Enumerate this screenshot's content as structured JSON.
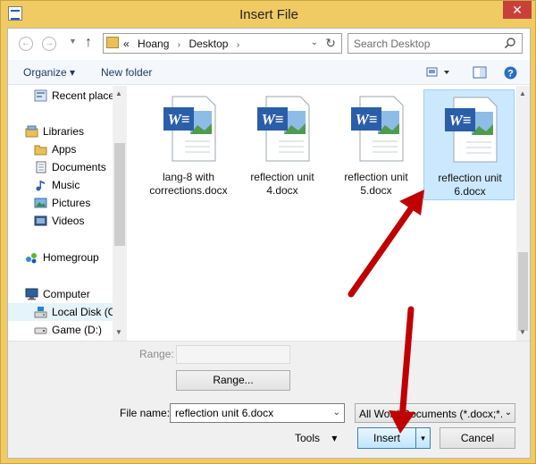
{
  "window": {
    "title": "Insert File",
    "close_glyph": "✕"
  },
  "address": {
    "back_glyph": "←",
    "forward_glyph": "→",
    "up_glyph": "↑",
    "overflow": "«",
    "crumbs": [
      "Hoang",
      "Desktop"
    ],
    "separator": "›",
    "dropdown_glyph": "⌄",
    "refresh_glyph": "↻"
  },
  "search": {
    "placeholder": "Search Desktop"
  },
  "command_bar": {
    "organize": "Organize ▾",
    "new_folder": "New folder"
  },
  "nav_pane": {
    "items": [
      {
        "label": "Recent places",
        "icon": "recent-places-icon"
      },
      {
        "label": "Libraries",
        "icon": "libraries-icon"
      },
      {
        "label": "Apps",
        "icon": "folder-icon"
      },
      {
        "label": "Documents",
        "icon": "documents-icon"
      },
      {
        "label": "Music",
        "icon": "music-icon"
      },
      {
        "label": "Pictures",
        "icon": "pictures-icon"
      },
      {
        "label": "Videos",
        "icon": "videos-icon"
      },
      {
        "label": "Homegroup",
        "icon": "homegroup-icon"
      },
      {
        "label": "Computer",
        "icon": "computer-icon"
      },
      {
        "label": "Local Disk (C:)",
        "icon": "local-disk-icon"
      },
      {
        "label": "Game (D:)",
        "icon": "drive-icon"
      }
    ],
    "selected": "Local Disk (C:)"
  },
  "files": [
    {
      "name_line1": "lang-8 with",
      "name_line2": "corrections.docx",
      "selected": false
    },
    {
      "name_line1": "reflection unit",
      "name_line2": "4.docx",
      "selected": false
    },
    {
      "name_line1": "reflection unit",
      "name_line2": "5.docx",
      "selected": false
    },
    {
      "name_line1": "reflection unit",
      "name_line2": "6.docx",
      "selected": true
    }
  ],
  "lower": {
    "range_label": "Range:",
    "range_button": "Range...",
    "file_name_label": "File name:",
    "file_name_value": "reflection unit 6.docx",
    "file_type": "All Word Documents (*.docx;*.d",
    "tools": "Tools",
    "tools_glyph": "▾",
    "insert": "Insert",
    "insert_split_glyph": "▾",
    "cancel": "Cancel"
  },
  "annotation_color": "#c00000"
}
